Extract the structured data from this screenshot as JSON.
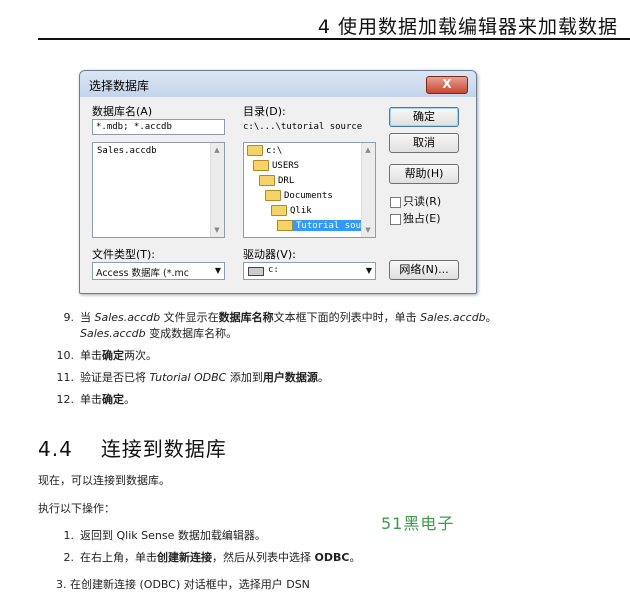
{
  "header": {
    "chapter_title": "4 使用数据加载编辑器来加载数据"
  },
  "dialog": {
    "title": "选择数据库",
    "close_label": "X",
    "db_name_label": "数据库名(A)",
    "db_name_value": "*.mdb; *.accdb",
    "db_list": [
      "Sales.accdb"
    ],
    "dir_label": "目录(D):",
    "dir_path": "c:\\...\\tutorial source",
    "dir_tree": [
      "c:\\",
      "USERS",
      "DRL",
      "Documents",
      "Qlik",
      "Tutorial sou"
    ],
    "ok_label": "确定",
    "cancel_label": "取消",
    "help_label": "帮助(H)",
    "readonly_label": "只读(R)",
    "exclusive_label": "独占(E)",
    "filetype_label": "文件类型(T):",
    "filetype_value": "Access 数据库 (*.mc",
    "drive_label": "驱动器(V):",
    "drive_value": "c:",
    "network_label": "网络(N)..."
  },
  "steps": [
    {
      "num": "9.",
      "text_a": "当 ",
      "i1": "Sales.accdb",
      "text_b": " 文件显示在",
      "b1": "数据库名称",
      "text_c": "文本框下面的列表中时，单击 ",
      "i2": "Sales.accdb",
      "text_d": "。",
      "i3": "Sales.accdb",
      "text_e": " 变成数据库名称。"
    },
    {
      "num": "10.",
      "text_a": "单击",
      "b1": "确定",
      "text_b": "两次。"
    },
    {
      "num": "11.",
      "text_a": "验证是否已将 ",
      "i1": "Tutorial ODBC",
      "text_b": " 添加到",
      "b1": "用户数据源",
      "text_c": "。"
    },
    {
      "num": "12.",
      "text_a": "单击",
      "b1": "确定",
      "text_b": "。"
    }
  ],
  "section": {
    "number": "4.4",
    "title": "连接到数据库"
  },
  "paragraphs": {
    "p1": "现在，可以连接到数据库。",
    "p2": "执行以下操作："
  },
  "steps2": [
    {
      "num": "1.",
      "text_a": "返回到 Qlik Sense 数据加载编辑器。"
    },
    {
      "num": "2.",
      "text_a": "在右上角，单击",
      "b1": "创建新连接",
      "text_b": "，然后从列表中选择 ",
      "b2": "ODBC",
      "text_c": "。"
    }
  ],
  "cut_line": "3.  在创建新连接 (ODBC) 对话框中，选择用户 DSN",
  "watermark": "51黑电子"
}
